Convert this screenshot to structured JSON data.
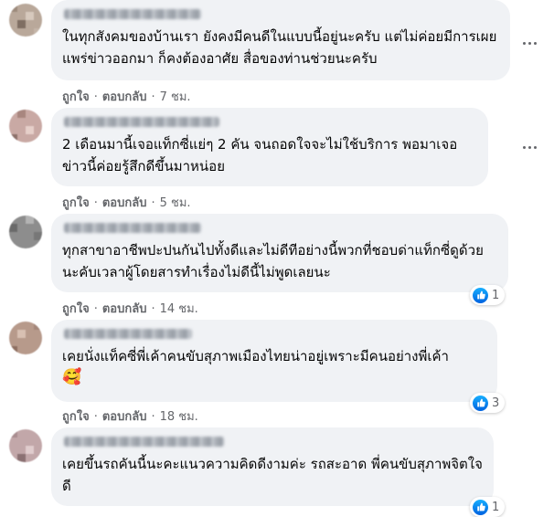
{
  "actions": {
    "like": "ถูกใจ",
    "reply": "ตอบกลับ",
    "separator": "·"
  },
  "comments": [
    {
      "text": "ในทุกสังคมของบ้านเรา ยังคงมีคนดีในแบบนี้อยู่นะครับ แต่ไม่ค่อยมีการเผยแพร่ข่าวออกมา ก็คงต้องอาศัย สื่อของท่านช่วยนะครับ",
      "time": "7 ชม.",
      "reaction_count": null
    },
    {
      "text": "2 เดือนมานี้เจอแท็กซี่แย่ๆ 2 คัน จนถอดใจจะไม่ใช้บริการ พอมาเจอข่าวนี้ค่อยรู้สึกดีขึ้นมาหน่อย",
      "time": "5 ชม.",
      "reaction_count": null
    },
    {
      "text": "ทุกสาขาอาชีพปะปนกันไปทั้งดีและไม่ดีทีอย่างนี้พวกที่ชอบด่าแท็กซี่ดูด้วยนะคับเวลาผู้โดยสารทำเรื่องไม่ดีนี้ไม่พูดเลยนะ",
      "time": "14 ชม.",
      "reaction_count": "1"
    },
    {
      "text": "เคยนั่งแท็คซี่พี่เค้าคนขับสุภาพเมืองไทยน่าอยู่เพราะมีคนอย่างพี่เค้า",
      "emoji": "🥰",
      "time": "18 ชม.",
      "reaction_count": "3"
    },
    {
      "text": "เคยขึ้นรถคันนี้นะคะแนวความคิดดีงามค่ะ รถสะอาด พี่คนขับสุภาพจิตใจดี",
      "time": "",
      "reaction_count": "1"
    }
  ],
  "colors": {
    "bubble": "#f0f2f5",
    "meta": "#65676b",
    "like_blue": "#0062df"
  }
}
